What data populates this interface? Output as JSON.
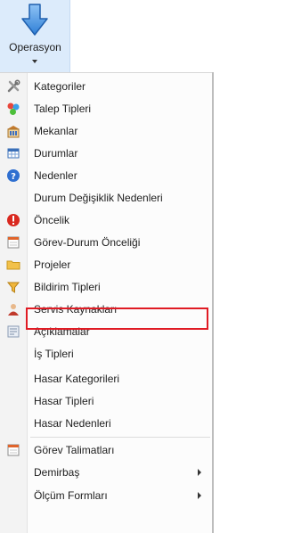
{
  "ribbon": {
    "label": "Operasyon"
  },
  "menu": {
    "items": [
      {
        "label": "Kategoriler",
        "icon": "tools-icon"
      },
      {
        "label": "Talep Tipleri",
        "icon": "shapes-icon"
      },
      {
        "label": "Mekanlar",
        "icon": "building-icon"
      },
      {
        "label": "Durumlar",
        "icon": "table-icon"
      },
      {
        "label": "Nedenler",
        "icon": "help-icon"
      },
      {
        "label": "Durum Değişiklik Nedenleri",
        "icon": ""
      },
      {
        "label": "Öncelik",
        "icon": "exclamation-icon"
      },
      {
        "label": "Görev-Durum Önceliği",
        "icon": "calendar-icon"
      },
      {
        "label": "Projeler",
        "icon": "folder-icon"
      },
      {
        "label": "Bildirim Tipleri",
        "icon": "funnel-icon"
      },
      {
        "label": "Servis Kaynakları",
        "icon": "person-icon"
      },
      {
        "label": "Açıklamalar",
        "icon": "note-icon"
      },
      {
        "label": "İş Tipleri",
        "icon": ""
      },
      {
        "label": "Hasar Kategorileri",
        "icon": ""
      },
      {
        "label": "Hasar Tipleri",
        "icon": ""
      },
      {
        "label": "Hasar Nedenleri",
        "icon": ""
      },
      {
        "label": "Görev Talimatları",
        "icon": "list-icon"
      },
      {
        "label": "Demirbaş",
        "icon": ""
      },
      {
        "label": "Ölçüm Formları",
        "icon": ""
      }
    ]
  },
  "colors": {
    "ribbon_bg": "#dcebfb",
    "highlight": "#e01b24"
  }
}
